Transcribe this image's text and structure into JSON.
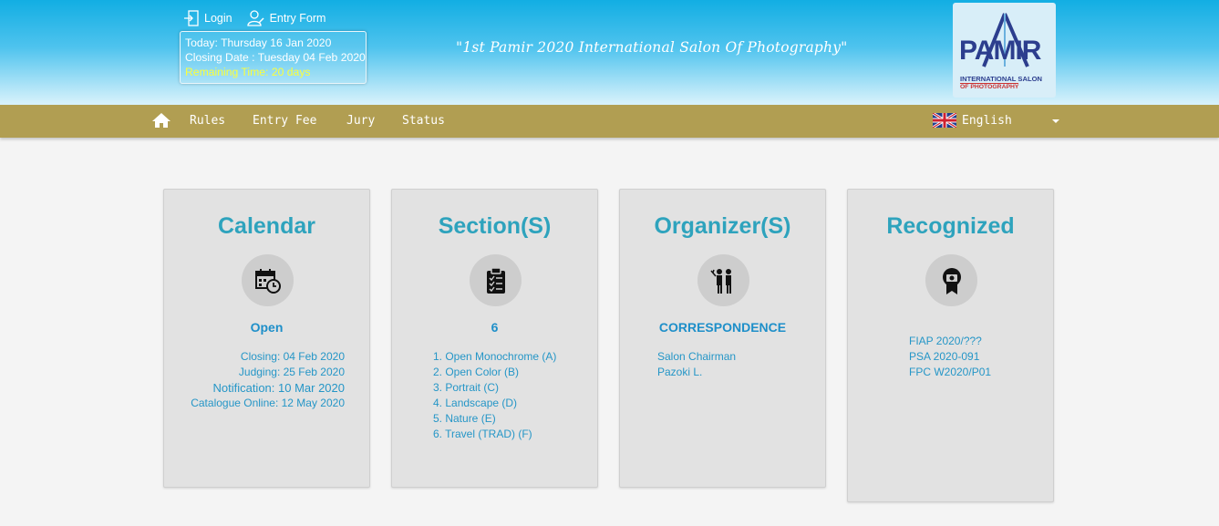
{
  "header": {
    "login_label": "Login",
    "entry_form_label": "Entry Form",
    "today": "Today: Thursday 16 Jan 2020",
    "closing": "Closing Date : Tuesday 04 Feb 2020",
    "remaining": "Remaining Time: 20 days",
    "salon_title": "\"1st Pamir 2020 International Salon Of Photography\"",
    "logo": {
      "main": "PAMIR",
      "sub1": "INTERNATIONAL SALON",
      "sub2": "OF PHOTOGRAPHY"
    }
  },
  "nav": {
    "home_icon": "home-icon",
    "items": [
      "Rules",
      "Entry Fee",
      "Jury",
      "Status"
    ],
    "language": "English"
  },
  "cards": {
    "calendar": {
      "title": "Calendar",
      "icon": "calendar-clock-icon",
      "status": "Open",
      "lines": [
        "Closing: 04 Feb 2020",
        "Judging: 25 Feb 2020",
        "Notification: 10 Mar 2020",
        "Catalogue Online: 12 May 2020"
      ]
    },
    "sections": {
      "title": "Section(S)",
      "icon": "clipboard-icon",
      "count": "6",
      "lines": [
        "1. Open Monochrome (A)",
        "2. Open Color (B)",
        "3. Portrait (C)",
        "4. Landscape (D)",
        "5. Nature (E)",
        "6. Travel (TRAD) (F)"
      ]
    },
    "organizers": {
      "title": "Organizer(S)",
      "icon": "organizer-people-icon",
      "heading": "CORRESPONDENCE",
      "lines": [
        "Salon Chairman",
        "Pazoki L."
      ]
    },
    "recognized": {
      "title": "Recognized",
      "icon": "camera-badge-icon",
      "lines": [
        "FIAP 2020/???",
        "PSA 2020-091",
        "FPC W2020/P01"
      ]
    }
  },
  "colors": {
    "accent": "#2ea3bd",
    "link": "#2596c7",
    "nav": "#b19e52",
    "header": "#12aee3",
    "remaining": "#fbff3c"
  }
}
